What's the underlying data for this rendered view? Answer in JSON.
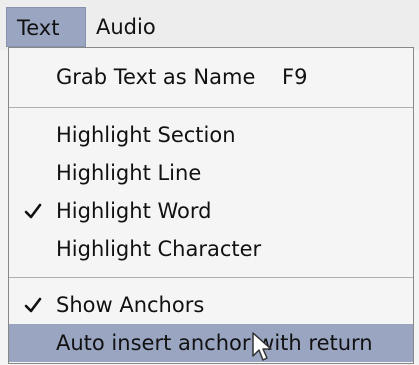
{
  "menubar": {
    "items": [
      {
        "label": "Text",
        "active": true
      },
      {
        "label": "Audio",
        "active": false
      }
    ]
  },
  "menu": {
    "items": [
      {
        "label": "Grab Text as Name",
        "shortcut": "F9"
      },
      {
        "label": "Highlight Section"
      },
      {
        "label": "Highlight Line"
      },
      {
        "label": "Highlight Word",
        "checked": true
      },
      {
        "label": "Highlight Character"
      },
      {
        "label": "Show Anchors",
        "checked": true
      },
      {
        "label": "Auto insert anchor with return",
        "highlighted": true
      }
    ]
  },
  "colors": {
    "highlight": "#9aa5c1",
    "menu_bg": "#f5f5f5",
    "separator": "#b0b0b0"
  },
  "icons": [
    "checkmark-icon",
    "mouse-pointer-icon"
  ]
}
